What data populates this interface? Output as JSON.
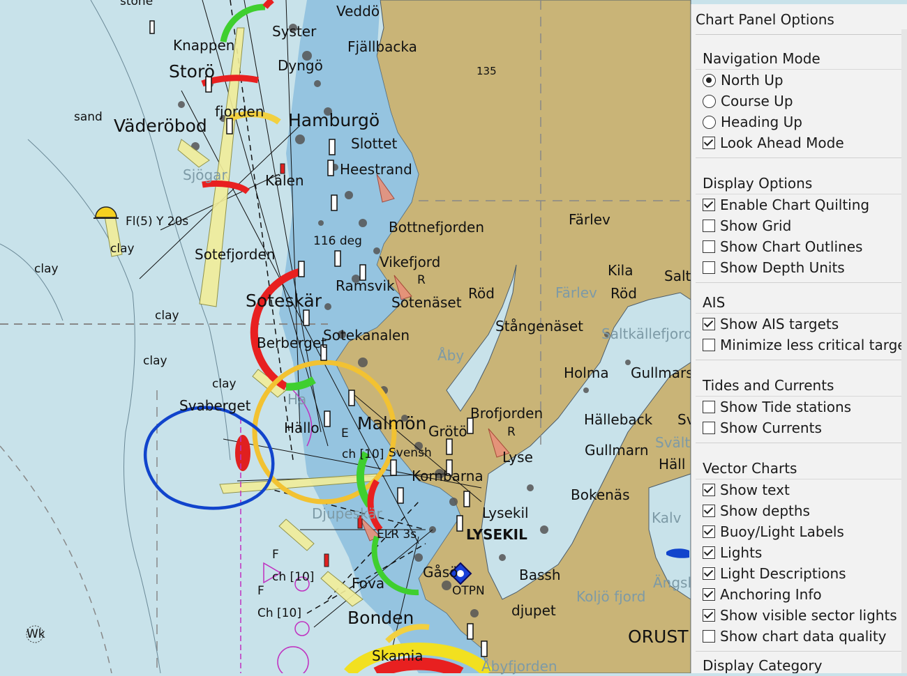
{
  "map": {
    "place_labels": [
      {
        "text": "Veddö",
        "size": "mid"
      },
      {
        "text": "Syster",
        "size": "mid"
      },
      {
        "text": "Fjällbacka",
        "size": "mid"
      },
      {
        "text": "Knappen",
        "size": "mid"
      },
      {
        "text": "Storö",
        "size": "big"
      },
      {
        "text": "Dyngö",
        "size": "mid"
      },
      {
        "text": "135",
        "size": "xs"
      },
      {
        "text": "sand",
        "size": "sm"
      },
      {
        "text": "Väderöbod",
        "size": "big"
      },
      {
        "text": "fjorden",
        "size": "mid"
      },
      {
        "text": "Hamburgö",
        "size": "big"
      },
      {
        "text": "Slottet",
        "size": "mid"
      },
      {
        "text": "Heestrand",
        "size": "mid"
      },
      {
        "text": "Sjögar",
        "size": "mid",
        "faded": true
      },
      {
        "text": "Kälen",
        "size": "mid"
      },
      {
        "text": "Fl(5) Y 20s",
        "size": "sm"
      },
      {
        "text": "clay",
        "size": "sm"
      },
      {
        "text": "Bottnefjorden",
        "size": "mid"
      },
      {
        "text": "Färlev",
        "size": "mid"
      },
      {
        "text": "clay",
        "size": "sm"
      },
      {
        "text": "116 deg",
        "size": "sm"
      },
      {
        "text": "Sotefjorden",
        "size": "mid"
      },
      {
        "text": "Vikefjord",
        "size": "mid"
      },
      {
        "text": "Kila",
        "size": "mid"
      },
      {
        "text": "Ramsvik",
        "size": "mid"
      },
      {
        "text": "R",
        "size": "sm"
      },
      {
        "text": "Salt",
        "size": "mid"
      },
      {
        "text": "Soteskär",
        "size": "big"
      },
      {
        "text": "Sotenäset",
        "size": "mid"
      },
      {
        "text": "Röd",
        "size": "mid"
      },
      {
        "text": "Färlev",
        "size": "mid",
        "faded": true
      },
      {
        "text": "Röd",
        "size": "mid"
      },
      {
        "text": "clay",
        "size": "sm"
      },
      {
        "text": "Stångenäset",
        "size": "mid"
      },
      {
        "text": "Saltkällefjord",
        "size": "mid",
        "faded": true
      },
      {
        "text": "Berberget",
        "size": "mid"
      },
      {
        "text": "Sotekanalen",
        "size": "mid"
      },
      {
        "text": "clay",
        "size": "sm"
      },
      {
        "text": "Åby",
        "size": "mid",
        "faded": true
      },
      {
        "text": "Holma",
        "size": "mid"
      },
      {
        "text": "Gullmars",
        "size": "mid"
      },
      {
        "text": "clay",
        "size": "sm"
      },
      {
        "text": "Svaberget",
        "size": "mid"
      },
      {
        "text": "Ha",
        "size": "mid",
        "faded": true
      },
      {
        "text": "Brofjorden",
        "size": "mid"
      },
      {
        "text": "Hälleback",
        "size": "mid"
      },
      {
        "text": "Sv",
        "size": "mid"
      },
      {
        "text": "Hällo",
        "size": "mid"
      },
      {
        "text": "Malmön",
        "size": "big"
      },
      {
        "text": "Grötö",
        "size": "mid"
      },
      {
        "text": "R",
        "size": "sm"
      },
      {
        "text": "E",
        "size": "sm"
      },
      {
        "text": "Svält",
        "size": "mid",
        "faded": true
      },
      {
        "text": "ch [10]",
        "size": "sm"
      },
      {
        "text": "Svensh",
        "size": "sm"
      },
      {
        "text": "Gullmarn",
        "size": "mid"
      },
      {
        "text": "Lyse",
        "size": "mid"
      },
      {
        "text": "Häll",
        "size": "mid"
      },
      {
        "text": "Kornbarna",
        "size": "mid"
      },
      {
        "text": "Bokenäs",
        "size": "mid"
      },
      {
        "text": "Lysekil",
        "size": "mid"
      },
      {
        "text": "Djupeskär",
        "size": "mid",
        "faded": true
      },
      {
        "text": "ELR 3s",
        "size": "sm"
      },
      {
        "text": "LYSEKIL",
        "size": "mid",
        "bold": true
      },
      {
        "text": "F",
        "size": "sm"
      },
      {
        "text": "Kalv",
        "size": "mid",
        "faded": true
      },
      {
        "text": "ch [10]",
        "size": "sm"
      },
      {
        "text": "Gåsö",
        "size": "mid"
      },
      {
        "text": "Bassh",
        "size": "mid"
      },
      {
        "text": "Ängsl",
        "size": "mid",
        "faded": true
      },
      {
        "text": "Fova",
        "size": "mid"
      },
      {
        "text": "OTPN",
        "size": "sm"
      },
      {
        "text": "Koljö fjord",
        "size": "mid",
        "faded": true
      },
      {
        "text": "F",
        "size": "sm"
      },
      {
        "text": "Ch [10]",
        "size": "sm"
      },
      {
        "text": "djupet",
        "size": "mid"
      },
      {
        "text": "Bonden",
        "size": "big"
      },
      {
        "text": "ORUST",
        "size": "big"
      },
      {
        "text": "Wk",
        "size": "sm"
      },
      {
        "text": "Skamia",
        "size": "mid"
      },
      {
        "text": "Åbyfjorden",
        "size": "mid",
        "faded": true
      },
      {
        "text": "stone",
        "size": "sm"
      }
    ]
  },
  "panel": {
    "title": "Chart Panel Options",
    "sections": [
      {
        "title": "Navigation Mode",
        "options": [
          {
            "type": "radio",
            "label": "North Up",
            "checked": true
          },
          {
            "type": "radio",
            "label": "Course Up",
            "checked": false
          },
          {
            "type": "radio",
            "label": "Heading Up",
            "checked": false
          },
          {
            "type": "checkbox",
            "label": "Look Ahead Mode",
            "checked": true
          }
        ]
      },
      {
        "title": "Display Options",
        "options": [
          {
            "type": "checkbox",
            "label": "Enable Chart Quilting",
            "checked": true
          },
          {
            "type": "checkbox",
            "label": "Show Grid",
            "checked": false
          },
          {
            "type": "checkbox",
            "label": "Show Chart Outlines",
            "checked": false
          },
          {
            "type": "checkbox",
            "label": "Show Depth Units",
            "checked": false
          }
        ]
      },
      {
        "title": "AIS",
        "options": [
          {
            "type": "checkbox",
            "label": "Show AIS targets",
            "checked": true
          },
          {
            "type": "checkbox",
            "label": "Minimize less critical targets",
            "checked": false
          }
        ]
      },
      {
        "title": "Tides and Currents",
        "options": [
          {
            "type": "checkbox",
            "label": "Show Tide stations",
            "checked": false
          },
          {
            "type": "checkbox",
            "label": "Show Currents",
            "checked": false
          }
        ]
      },
      {
        "title": "Vector Charts",
        "options": [
          {
            "type": "checkbox",
            "label": "Show text",
            "checked": true
          },
          {
            "type": "checkbox",
            "label": "Show depths",
            "checked": true
          },
          {
            "type": "checkbox",
            "label": "Buoy/Light Labels",
            "checked": true
          },
          {
            "type": "checkbox",
            "label": "Lights",
            "checked": true
          },
          {
            "type": "checkbox",
            "label": "Light Descriptions",
            "checked": true
          },
          {
            "type": "checkbox",
            "label": "Anchoring Info",
            "checked": true
          },
          {
            "type": "checkbox",
            "label": "Show visible sector lights",
            "checked": true
          },
          {
            "type": "checkbox",
            "label": "Show chart data quality",
            "checked": false
          }
        ]
      },
      {
        "title": "Display Category",
        "options": []
      }
    ]
  },
  "colors": {
    "sea": "#c8e2ea",
    "land": "#c9b477",
    "shallow": "#7fb8dc",
    "annotation": "#1144cc"
  }
}
